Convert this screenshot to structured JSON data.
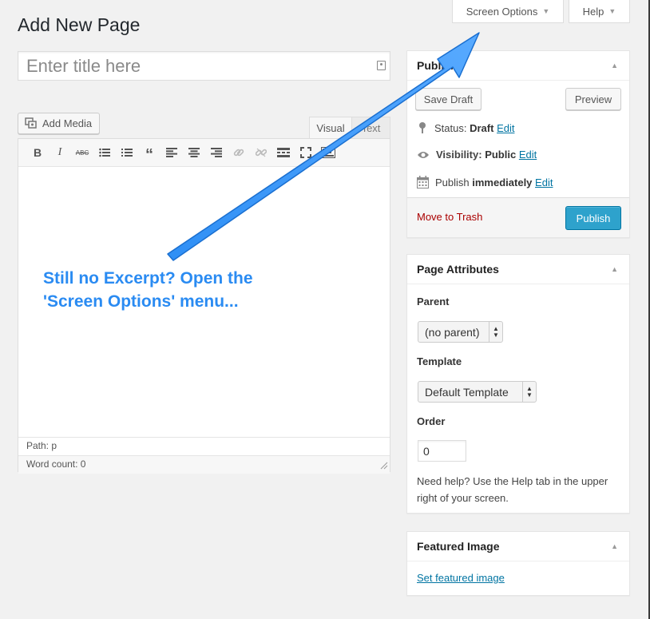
{
  "header": {
    "title": "Add New Page",
    "screen_options": "Screen Options",
    "help": "Help"
  },
  "title_field": {
    "placeholder": "Enter title here",
    "value": ""
  },
  "media": {
    "add_media": "Add Media"
  },
  "editor": {
    "tabs": [
      "Visual",
      "Text"
    ],
    "active_tab": "Visual",
    "toolbar": [
      "bold",
      "italic",
      "strikethrough",
      "bullet-list",
      "numbered-list",
      "blockquote",
      "align-left",
      "align-center",
      "align-right",
      "link",
      "unlink",
      "read-more",
      "fullscreen",
      "toolbar-toggle"
    ],
    "toolbar_labels": {
      "bold": "B",
      "italic": "I",
      "strikethrough": "ABC"
    },
    "path": "Path: p",
    "word_count": "Word count: 0"
  },
  "publish": {
    "title": "Publish",
    "save_draft": "Save Draft",
    "preview": "Preview",
    "status_label": "Status:",
    "status_value": "Draft",
    "visibility_label": "Visibility:",
    "visibility_value": "Public",
    "publish_label": "Publish",
    "publish_value": "immediately",
    "edit": "Edit",
    "move_to_trash": "Move to Trash",
    "publish_button": "Publish"
  },
  "page_attributes": {
    "title": "Page Attributes",
    "parent_label": "Parent",
    "parent_value": "(no parent)",
    "template_label": "Template",
    "template_value": "Default Template",
    "order_label": "Order",
    "order_value": "0",
    "help_text": "Need help? Use the Help tab in the upper right of your screen."
  },
  "featured_image": {
    "title": "Featured Image",
    "set_link": "Set featured image"
  },
  "annotation": {
    "text": "Still no Excerpt? Open the 'Screen Options' menu...",
    "color": "#2a8bf2"
  },
  "colors": {
    "accent": "#2ea2cc",
    "link": "#0074a2",
    "trash": "#a00000"
  }
}
